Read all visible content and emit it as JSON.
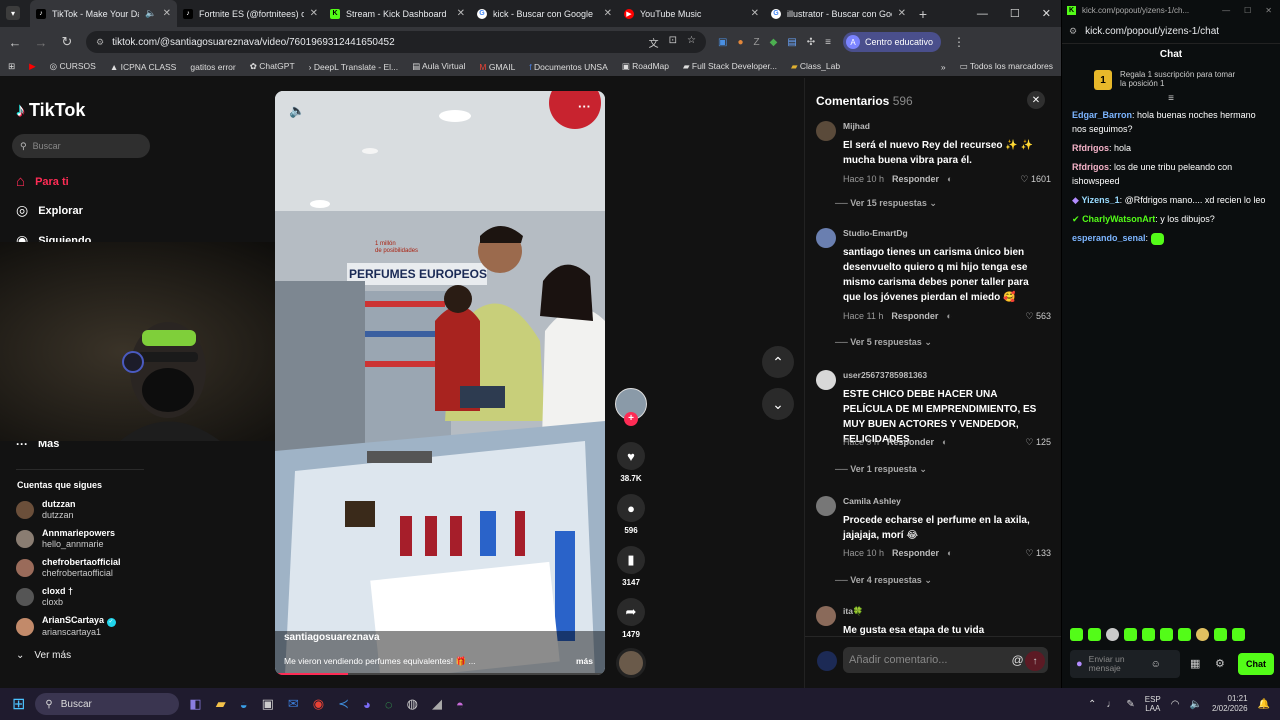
{
  "browser": {
    "tabs": [
      {
        "title": "TikTok - Make Your Day",
        "icon": "tiktok-icon",
        "color": "#ffffff"
      },
      {
        "title": "Fortnite ES (@fortnitees) of...",
        "icon": "tiktok-icon",
        "color": "#ffffff"
      },
      {
        "title": "Stream - Kick Dashboard",
        "icon": "kick-icon",
        "color": "#53fc18"
      },
      {
        "title": "kick - Buscar con Google",
        "icon": "google-icon",
        "color": "#4285f4"
      },
      {
        "title": "YouTube Music",
        "icon": "youtube-music-icon",
        "color": "#ff0000"
      },
      {
        "title": "illustrator - Buscar con Goo...",
        "icon": "google-icon",
        "color": "#4285f4"
      }
    ],
    "url": "tiktok.com/@santiagosuareznava/video/7601969312441650452",
    "profile_label": "Centro educativo",
    "profile_initial": "A",
    "bookmarks": [
      "CURSOS",
      "ICPNA CLASS",
      "gatitos error",
      "ChatGPT",
      "DeepL Translate - El...",
      "Aula Virtual",
      "GMAIL",
      "Documentos UNSA",
      "RoadMap",
      "Full Stack Developer...",
      "Class_Lab"
    ],
    "bookmarks_all": "Todos los marcadores"
  },
  "tiktok": {
    "logo": "TikTok",
    "search_placeholder": "Buscar",
    "nav": [
      {
        "label": "Para ti",
        "icon": "home-icon"
      },
      {
        "label": "Explorar",
        "icon": "compass-icon"
      },
      {
        "label": "Siguiendo",
        "icon": "following-icon"
      }
    ],
    "more_label": "Más",
    "following_title": "Cuentas que sigues",
    "following": [
      {
        "name": "dutzzan",
        "handle": "dutzzan",
        "color": "#6b4f3a"
      },
      {
        "name": "Annmariepowers",
        "handle": "hello_annmarie",
        "color": "#8a7d72"
      },
      {
        "name": "chefrobertaofficial",
        "handle": "chefrobertaofficial",
        "color": "#9a6b5a"
      },
      {
        "name": "cloxd †",
        "handle": "cloxb",
        "color": "#555555"
      },
      {
        "name": "ArianSCartaya",
        "handle": "arianscartaya1",
        "color": "#c28a6a"
      }
    ],
    "see_more": "Ver más",
    "video": {
      "author": "santiagosuareznava",
      "caption": "Me vieron vendiendo perfumes equivalentes! 🎁 ...",
      "caption_more": "más",
      "store_sign": "PERFUMES EUROPEOS",
      "store_badge_top": "1 millón",
      "store_badge_bottom": "de posibilidades"
    },
    "actions": {
      "likes": "38.7K",
      "comments": "596",
      "saves": "3147",
      "shares": "1479"
    },
    "comments_title": "Comentarios",
    "comments_count": "596",
    "comments": [
      {
        "user": "Mijhad",
        "text": "El será el nuevo Rey del recurseo ✨ ✨ mucha buena vibra para él.",
        "time": "Hace 10 h",
        "likes": "1601",
        "replies": "Ver 15 respuestas",
        "color": "#5a4a3a"
      },
      {
        "user": "Studio-EmartDg",
        "text": "santiago tienes un carisma único bien desenvuelto quiero q mi hijo tenga ese mismo carisma debes poner taller para que los jóvenes pierdan el miedo 🥰",
        "time": "Hace 11 h",
        "likes": "563",
        "replies": "Ver 5 respuestas",
        "color": "#6a7fb0"
      },
      {
        "user": "user25673785981363",
        "text": "ESTE CHICO DEBE HACER UNA PELÍCULA DE MI EMPRENDIMIENTO, ES MUY BUEN ACTORES Y VENDEDOR, FELICIDADES",
        "time": "Hace 9 h",
        "likes": "125",
        "replies": "Ver 1 respuesta",
        "color": "#d8d8d8"
      },
      {
        "user": "Camila Ashley",
        "text": "Procede echarse el perfume en la axila, jajajaja, morí 😂",
        "time": "Hace 10 h",
        "likes": "133",
        "replies": "Ver 4 respuestas",
        "color": "#777777"
      },
      {
        "user": "ita🍀",
        "text": "Me gusta esa etapa de tu vida",
        "time": "",
        "likes": "",
        "replies": "",
        "color": "#8a6a5a"
      }
    ],
    "reply_label": "Responder",
    "comment_placeholder": "Añadir comentario..."
  },
  "kick_chat": {
    "window_url": "kick.com/popout/yizens-1/ch...",
    "url": "kick.com/popout/yizens-1/chat",
    "title": "Chat",
    "sub_badge": "1",
    "sub_banner": "Regala 1 suscripción para tomar la posición 1",
    "messages": [
      {
        "user": "Edgar_Barron",
        "text": "hola buenas noches hermano nos seguimos?",
        "color": "#7cb5ff"
      },
      {
        "user": "Rfdrigos",
        "text": "hola",
        "color": "#f5b3c8"
      },
      {
        "user": "Rfdrigos",
        "text": "los de une tribu peleando con ishowspeed",
        "color": "#f5b3c8"
      },
      {
        "user": "Yizens_1",
        "text": "@Rfdrigos mano.... xd recien lo leo",
        "color": "#9adcff"
      },
      {
        "user": "CharlyWatsonArt",
        "text": "y los dibujos?",
        "color": "#53fc18"
      },
      {
        "user": "esperando_senal",
        "text": "",
        "color": "#7cb5ff"
      }
    ],
    "input_placeholder": "Enviar un mensaje",
    "send_label": "Chat"
  },
  "taskbar": {
    "search_label": "Buscar",
    "lang_top": "ESP",
    "lang_bottom": "LAA",
    "time": "01:21",
    "date": "2/02/2026"
  },
  "colors": {
    "accent_red": "#fe2c55",
    "kick_green": "#53fc18",
    "taskbar": "#1f1b2e"
  }
}
